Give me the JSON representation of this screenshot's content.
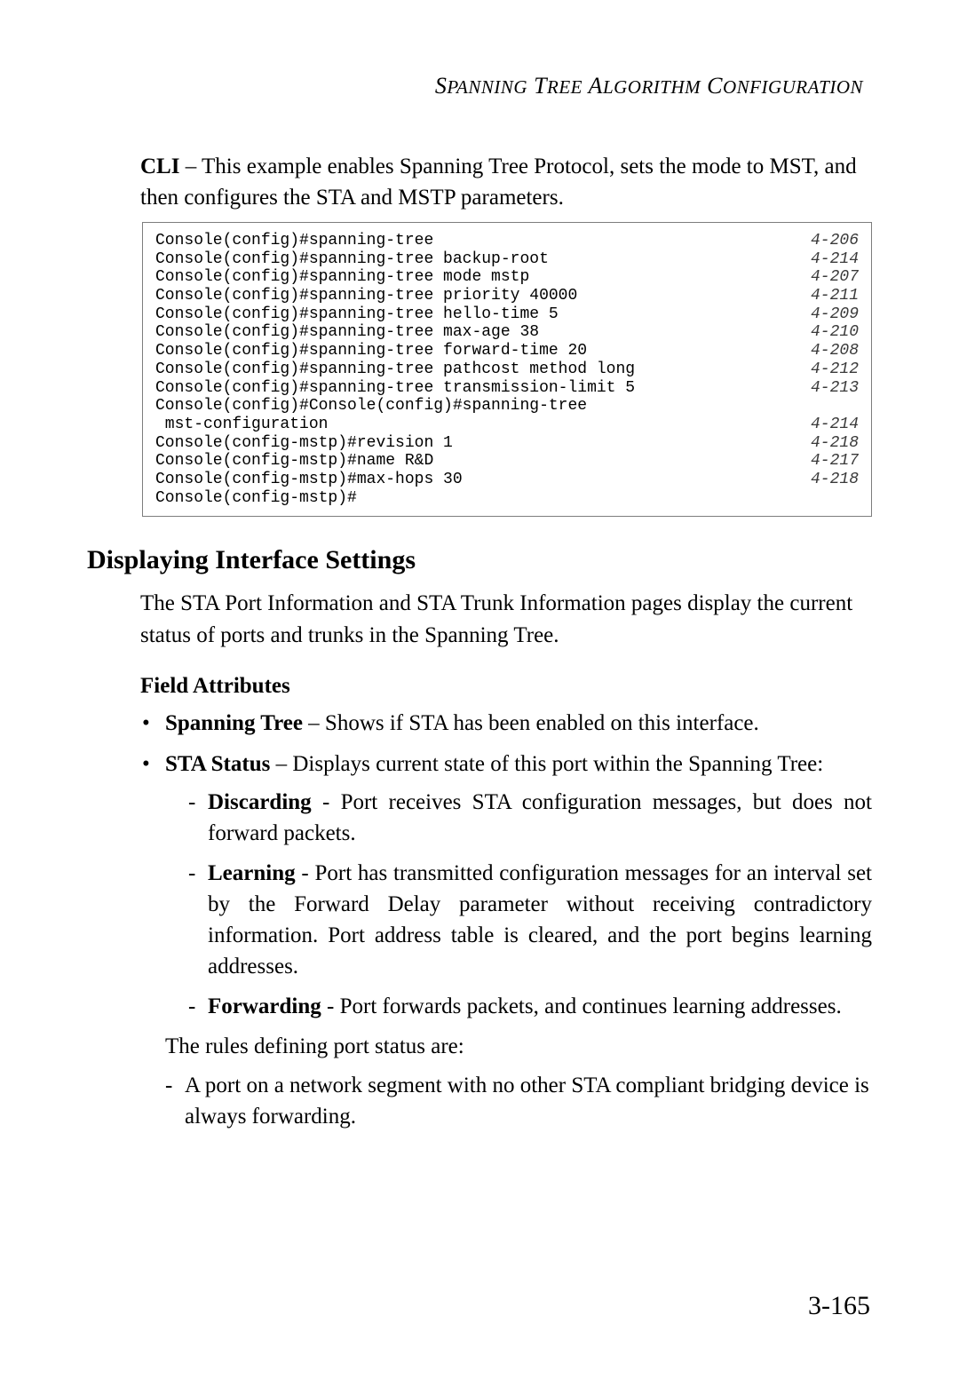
{
  "running_head_html": "S<span style='font-size:21px'>PANNING</span> T<span style='font-size:21px'>REE</span> A<span style='font-size:21px'>LGORITHM</span> C<span style='font-size:21px'>ONFIGURATION</span>",
  "cli_intro": {
    "label": "CLI",
    "text": " – This example enables Spanning Tree Protocol, sets the mode to MST, and then configures the STA and MSTP parameters."
  },
  "cli_lines": [
    {
      "cmd": "Console(config)#spanning-tree",
      "ref": "4-206"
    },
    {
      "cmd": "Console(config)#spanning-tree backup-root",
      "ref": "4-214"
    },
    {
      "cmd": "Console(config)#spanning-tree mode mstp",
      "ref": "4-207"
    },
    {
      "cmd": "Console(config)#spanning-tree priority 40000",
      "ref": "4-211"
    },
    {
      "cmd": "Console(config)#spanning-tree hello-time 5",
      "ref": "4-209"
    },
    {
      "cmd": "Console(config)#spanning-tree max-age 38",
      "ref": "4-210"
    },
    {
      "cmd": "Console(config)#spanning-tree forward-time 20",
      "ref": "4-208"
    },
    {
      "cmd": "Console(config)#spanning-tree pathcost method long",
      "ref": "4-212"
    },
    {
      "cmd": "Console(config)#spanning-tree transmission-limit 5",
      "ref": "4-213"
    },
    {
      "cmd": "Console(config)#Console(config)#spanning-tree",
      "ref": ""
    },
    {
      "cmd": " mst-configuration",
      "ref": "4-214"
    },
    {
      "cmd": "Console(config-mstp)#revision 1",
      "ref": "4-218"
    },
    {
      "cmd": "Console(config-mstp)#name R&D",
      "ref": "4-217"
    },
    {
      "cmd": "Console(config-mstp)#max-hops 30",
      "ref": "4-218"
    },
    {
      "cmd": "Console(config-mstp)#",
      "ref": ""
    }
  ],
  "section_heading": "Displaying Interface Settings",
  "section_para": "The STA Port Information and STA Trunk Information pages display the current status of ports and trunks in the Spanning Tree.",
  "field_attributes_heading": "Field Attributes",
  "bullets": [
    {
      "term": "Spanning Tree",
      "desc": " – Shows if STA has been enabled on this interface."
    },
    {
      "term": "STA Status",
      "desc": " – Displays current state of this port within the Spanning Tree:"
    }
  ],
  "status_items": [
    {
      "term": "Discarding",
      "desc": " - Port receives STA configuration messages, but does not forward packets."
    },
    {
      "term": "Learning",
      "desc": " - Port has transmitted configuration messages for an interval set by the Forward Delay parameter without receiving contradictory information. Port address table is cleared, and the port begins learning addresses."
    },
    {
      "term": "Forwarding",
      "desc": " - Port forwards packets, and continues learning addresses."
    }
  ],
  "rules_intro": "The rules defining port status are:",
  "rules": [
    "A port on a network segment with no other STA compliant bridging device is always forwarding."
  ],
  "page_number": "3-165"
}
